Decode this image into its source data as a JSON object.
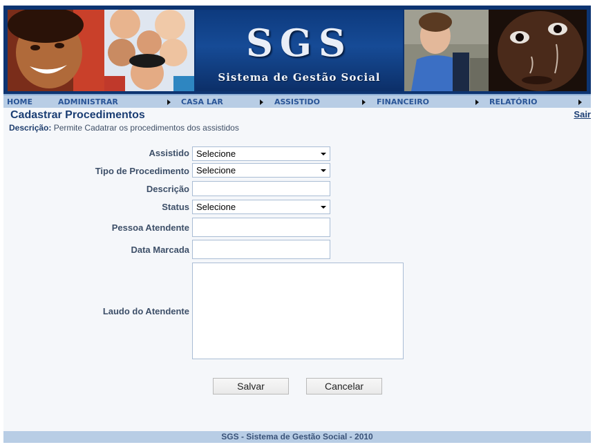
{
  "banner": {
    "title": "SGS",
    "subtitle": "Sistema de Gestão Social"
  },
  "nav": {
    "items": [
      {
        "label": "HOME"
      },
      {
        "label": "ADMINISTRAR"
      },
      {
        "label": "CASA LAR"
      },
      {
        "label": "ASSISTIDO"
      },
      {
        "label": "FINANCEIRO"
      },
      {
        "label": "RELATÓRIO"
      }
    ]
  },
  "header": {
    "title": "Cadastrar Procedimentos",
    "logout": "Sair",
    "description_label": "Descrição:",
    "description_text": "Permite Cadatrar os procedimentos dos assistidos"
  },
  "form": {
    "assistido": {
      "label": "Assistido",
      "value": "Selecione"
    },
    "tipo": {
      "label": "Tipo de Procedimento",
      "value": "Selecione"
    },
    "descricao": {
      "label": "Descrição",
      "value": ""
    },
    "status": {
      "label": "Status",
      "value": "Selecione"
    },
    "pessoa": {
      "label": "Pessoa Atendente",
      "value": ""
    },
    "data": {
      "label": "Data Marcada",
      "value": ""
    },
    "laudo": {
      "label": "Laudo do Atendente",
      "value": ""
    },
    "save_label": "Salvar",
    "cancel_label": "Cancelar"
  },
  "footer": {
    "text": "SGS - Sistema de Gestão Social - 2010"
  },
  "colors": {
    "banner_bg": "#0d3471",
    "nav_bg": "#b8cde5",
    "title_color": "#1a3d73"
  }
}
